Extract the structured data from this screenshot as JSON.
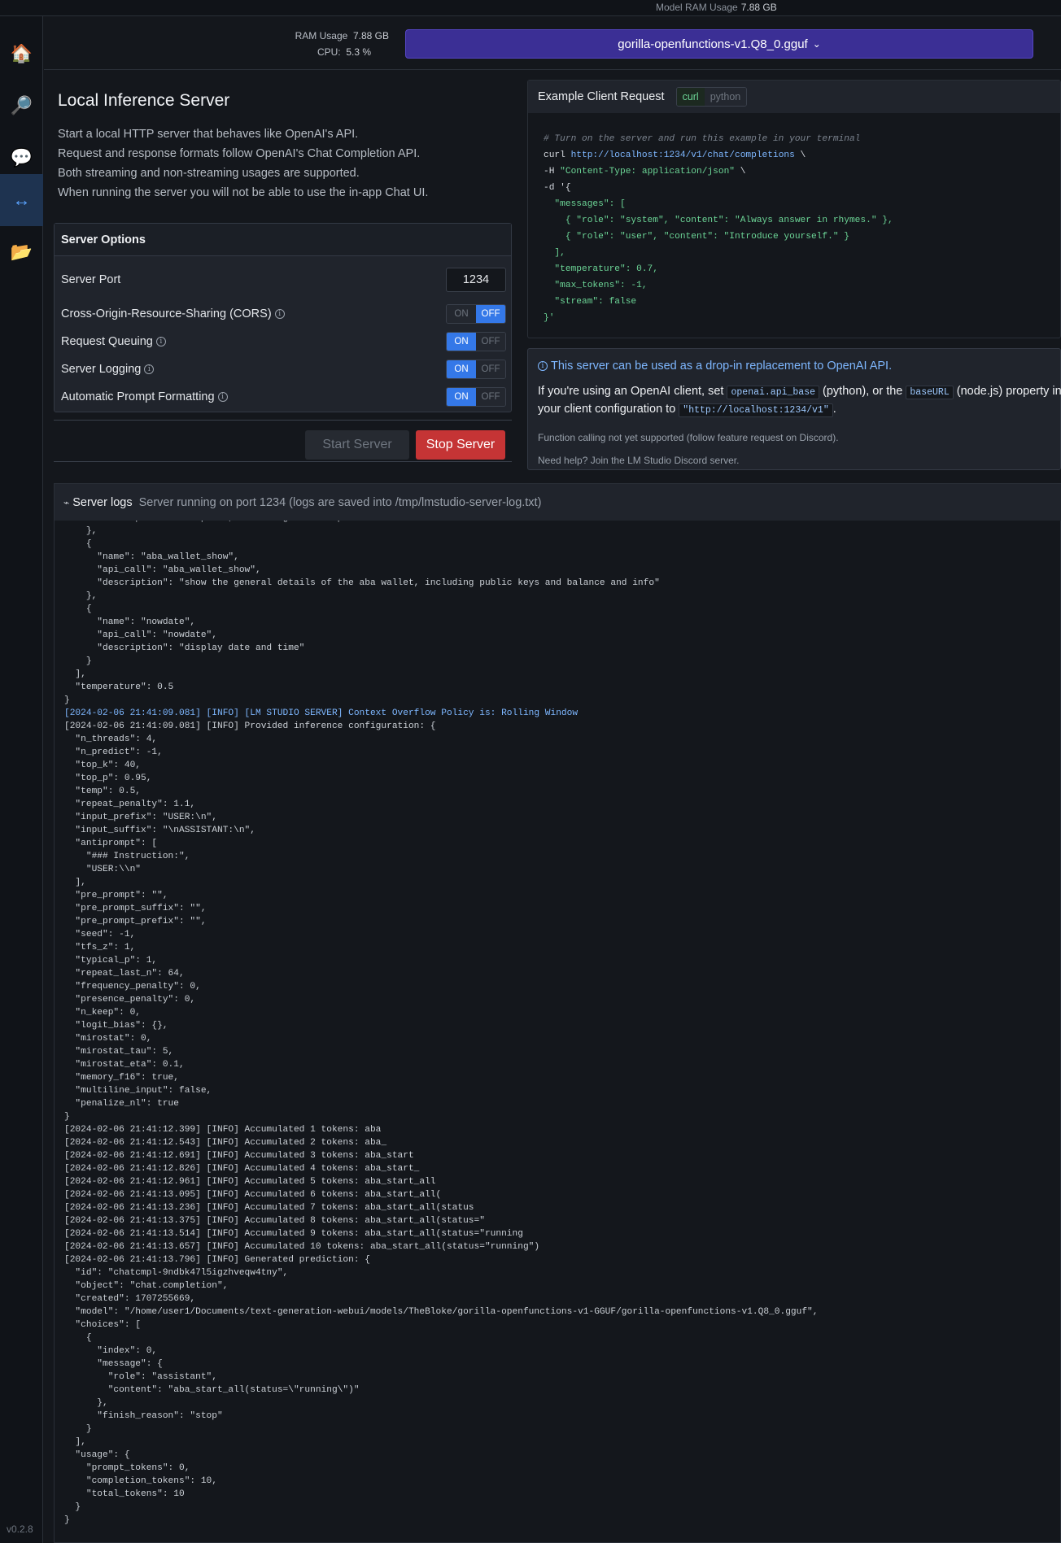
{
  "topbar": {
    "ram_label": "Model RAM Usage",
    "ram_value": "7.88 GB"
  },
  "sidebar": {
    "items": [
      {
        "name": "home",
        "icon": "🏠"
      },
      {
        "name": "search",
        "icon": "🔎"
      },
      {
        "name": "chat",
        "icon": "💬"
      },
      {
        "name": "server",
        "icon": "↔"
      },
      {
        "name": "folder",
        "icon": "📂"
      }
    ],
    "version": "v0.2.8"
  },
  "header": {
    "ram_label": "RAM Usage",
    "ram_value": "7.88 GB",
    "cpu_label": "CPU:",
    "cpu_value": "5.3 %",
    "model": "gorilla-openfunctions-v1.Q8_0.gguf",
    "model_chevron": "⌄"
  },
  "server": {
    "title": "Local Inference Server",
    "description": [
      "Start a local HTTP server that behaves like OpenAI's API.",
      "Request and response formats follow OpenAI's Chat Completion API.",
      "Both streaming and non-streaming usages are supported.",
      "When running the server you will not be able to use the in-app Chat UI."
    ],
    "options_title": "Server Options",
    "port_label": "Server Port",
    "port_value": "1234",
    "cors_label": "Cross-Origin-Resource-Sharing (CORS)",
    "queuing_label": "Request Queuing",
    "logging_label": "Server Logging",
    "formatting_label": "Automatic Prompt Formatting",
    "toggle_on": "ON",
    "toggle_off": "OFF",
    "toggles": {
      "cors": false,
      "queuing": true,
      "logging": true,
      "formatting": true
    },
    "start_label": "Start Server",
    "stop_label": "Stop Server"
  },
  "example": {
    "title": "Example Client Request",
    "tab_curl": "curl",
    "tab_python": "python",
    "code": {
      "comment": "# Turn on the server and run this example in your terminal",
      "curl": "curl ",
      "url": "http://localhost:1234/v1/chat/completions",
      "cont": " \\",
      "h_flag": "-H ",
      "h_value": "\"Content-Type: application/json\"",
      "d_flag": "-d '{",
      "l_messages": "  \"messages\": [",
      "l_sys": "    { \"role\": \"system\", \"content\": \"Always answer in rhymes.\" },",
      "l_user": "    { \"role\": \"user\", \"content\": \"Introduce yourself.\" }",
      "l_close": "  ],",
      "l_temp": "  \"temperature\": 0.7,",
      "l_max": "  \"max_tokens\": -1,",
      "l_stream": "  \"stream\": false",
      "l_end": "}'"
    }
  },
  "note": {
    "title": "This server can be used as a drop-in replacement to OpenAI API.",
    "body_1": "If you're using an OpenAI client, set ",
    "chip_1": "openai.api_base",
    "body_2": " (python), or the ",
    "chip_2": "baseURL",
    "body_3": " (node.js) property in your client configuration to ",
    "chip_3": "\"http://localhost:1234/v1\"",
    "body_4": ".",
    "function_note": "Function calling not yet supported (follow feature request on Discord).",
    "help": "Need help? Join the LM Studio Discord server."
  },
  "logs": {
    "title": "Server logs",
    "subtitle": "Server running on port 1234 (logs are saved into /tmp/lmstudio-server-log.txt)",
    "lines": [
      "      \"description\": \"stop aba, including all aba processes\"",
      "    },",
      "    {",
      "      \"name\": \"aba_wallet_show\",",
      "      \"api_call\": \"aba_wallet_show\",",
      "      \"description\": \"show the general details of the aba wallet, including public keys and balance and info\"",
      "    },",
      "    {",
      "      \"name\": \"nowdate\",",
      "      \"api_call\": \"nowdate\",",
      "      \"description\": \"display date and time\"",
      "    }",
      "  ],",
      "  \"temperature\": 0.5",
      "}",
      "[2024-02-06 21:41:09.081] [INFO] [LM STUDIO SERVER] Context Overflow Policy is: Rolling Window",
      "[2024-02-06 21:41:09.081] [INFO] Provided inference configuration: {",
      "  \"n_threads\": 4,",
      "  \"n_predict\": -1,",
      "  \"top_k\": 40,",
      "  \"top_p\": 0.95,",
      "  \"temp\": 0.5,",
      "  \"repeat_penalty\": 1.1,",
      "  \"input_prefix\": \"USER:\\n\",",
      "  \"input_suffix\": \"\\nASSISTANT:\\n\",",
      "  \"antiprompt\": [",
      "    \"### Instruction:\",",
      "    \"USER:\\\\n\"",
      "  ],",
      "  \"pre_prompt\": \"\",",
      "  \"pre_prompt_suffix\": \"\",",
      "  \"pre_prompt_prefix\": \"\",",
      "  \"seed\": -1,",
      "  \"tfs_z\": 1,",
      "  \"typical_p\": 1,",
      "  \"repeat_last_n\": 64,",
      "  \"frequency_penalty\": 0,",
      "  \"presence_penalty\": 0,",
      "  \"n_keep\": 0,",
      "  \"logit_bias\": {},",
      "  \"mirostat\": 0,",
      "  \"mirostat_tau\": 5,",
      "  \"mirostat_eta\": 0.1,",
      "  \"memory_f16\": true,",
      "  \"multiline_input\": false,",
      "  \"penalize_nl\": true",
      "}",
      "[2024-02-06 21:41:12.399] [INFO] Accumulated 1 tokens: aba",
      "[2024-02-06 21:41:12.543] [INFO] Accumulated 2 tokens: aba_",
      "[2024-02-06 21:41:12.691] [INFO] Accumulated 3 tokens: aba_start",
      "[2024-02-06 21:41:12.826] [INFO] Accumulated 4 tokens: aba_start_",
      "[2024-02-06 21:41:12.961] [INFO] Accumulated 5 tokens: aba_start_all",
      "[2024-02-06 21:41:13.095] [INFO] Accumulated 6 tokens: aba_start_all(",
      "[2024-02-06 21:41:13.236] [INFO] Accumulated 7 tokens: aba_start_all(status",
      "[2024-02-06 21:41:13.375] [INFO] Accumulated 8 tokens: aba_start_all(status=\"",
      "[2024-02-06 21:41:13.514] [INFO] Accumulated 9 tokens: aba_start_all(status=\"running",
      "[2024-02-06 21:41:13.657] [INFO] Accumulated 10 tokens: aba_start_all(status=\"running\")",
      "[2024-02-06 21:41:13.796] [INFO] Generated prediction: {",
      "  \"id\": \"chatcmpl-9ndbk47l5igzhveqw4tny\",",
      "  \"object\": \"chat.completion\",",
      "  \"created\": 1707255669,",
      "  \"model\": \"/home/user1/Documents/text-generation-webui/models/TheBloke/gorilla-openfunctions-v1-GGUF/gorilla-openfunctions-v1.Q8_0.gguf\",",
      "  \"choices\": [",
      "    {",
      "      \"index\": 0,",
      "      \"message\": {",
      "        \"role\": \"assistant\",",
      "        \"content\": \"aba_start_all(status=\\\"running\\\")\"",
      "      },",
      "      \"finish_reason\": \"stop\"",
      "    }",
      "  ],",
      "  \"usage\": {",
      "    \"prompt_tokens\": 0,",
      "    \"completion_tokens\": 10,",
      "    \"total_tokens\": 10",
      "  }",
      "}"
    ],
    "highlight_line": 15
  }
}
